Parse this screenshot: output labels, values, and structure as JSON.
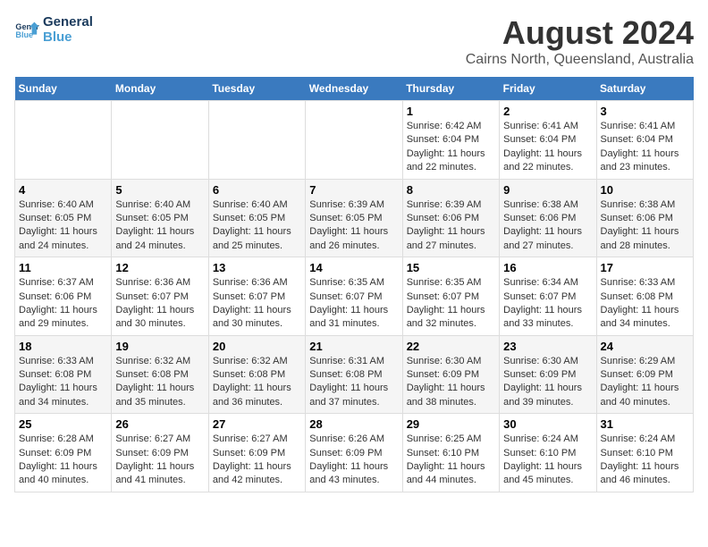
{
  "logo": {
    "line1": "General",
    "line2": "Blue"
  },
  "title": "August 2024",
  "subtitle": "Cairns North, Queensland, Australia",
  "days_header": [
    "Sunday",
    "Monday",
    "Tuesday",
    "Wednesday",
    "Thursday",
    "Friday",
    "Saturday"
  ],
  "weeks": [
    [
      {
        "day": "",
        "info": ""
      },
      {
        "day": "",
        "info": ""
      },
      {
        "day": "",
        "info": ""
      },
      {
        "day": "",
        "info": ""
      },
      {
        "day": "1",
        "info": "Sunrise: 6:42 AM\nSunset: 6:04 PM\nDaylight: 11 hours and 22 minutes."
      },
      {
        "day": "2",
        "info": "Sunrise: 6:41 AM\nSunset: 6:04 PM\nDaylight: 11 hours and 22 minutes."
      },
      {
        "day": "3",
        "info": "Sunrise: 6:41 AM\nSunset: 6:04 PM\nDaylight: 11 hours and 23 minutes."
      }
    ],
    [
      {
        "day": "4",
        "info": "Sunrise: 6:40 AM\nSunset: 6:05 PM\nDaylight: 11 hours and 24 minutes."
      },
      {
        "day": "5",
        "info": "Sunrise: 6:40 AM\nSunset: 6:05 PM\nDaylight: 11 hours and 24 minutes."
      },
      {
        "day": "6",
        "info": "Sunrise: 6:40 AM\nSunset: 6:05 PM\nDaylight: 11 hours and 25 minutes."
      },
      {
        "day": "7",
        "info": "Sunrise: 6:39 AM\nSunset: 6:05 PM\nDaylight: 11 hours and 26 minutes."
      },
      {
        "day": "8",
        "info": "Sunrise: 6:39 AM\nSunset: 6:06 PM\nDaylight: 11 hours and 27 minutes."
      },
      {
        "day": "9",
        "info": "Sunrise: 6:38 AM\nSunset: 6:06 PM\nDaylight: 11 hours and 27 minutes."
      },
      {
        "day": "10",
        "info": "Sunrise: 6:38 AM\nSunset: 6:06 PM\nDaylight: 11 hours and 28 minutes."
      }
    ],
    [
      {
        "day": "11",
        "info": "Sunrise: 6:37 AM\nSunset: 6:06 PM\nDaylight: 11 hours and 29 minutes."
      },
      {
        "day": "12",
        "info": "Sunrise: 6:36 AM\nSunset: 6:07 PM\nDaylight: 11 hours and 30 minutes."
      },
      {
        "day": "13",
        "info": "Sunrise: 6:36 AM\nSunset: 6:07 PM\nDaylight: 11 hours and 30 minutes."
      },
      {
        "day": "14",
        "info": "Sunrise: 6:35 AM\nSunset: 6:07 PM\nDaylight: 11 hours and 31 minutes."
      },
      {
        "day": "15",
        "info": "Sunrise: 6:35 AM\nSunset: 6:07 PM\nDaylight: 11 hours and 32 minutes."
      },
      {
        "day": "16",
        "info": "Sunrise: 6:34 AM\nSunset: 6:07 PM\nDaylight: 11 hours and 33 minutes."
      },
      {
        "day": "17",
        "info": "Sunrise: 6:33 AM\nSunset: 6:08 PM\nDaylight: 11 hours and 34 minutes."
      }
    ],
    [
      {
        "day": "18",
        "info": "Sunrise: 6:33 AM\nSunset: 6:08 PM\nDaylight: 11 hours and 34 minutes."
      },
      {
        "day": "19",
        "info": "Sunrise: 6:32 AM\nSunset: 6:08 PM\nDaylight: 11 hours and 35 minutes."
      },
      {
        "day": "20",
        "info": "Sunrise: 6:32 AM\nSunset: 6:08 PM\nDaylight: 11 hours and 36 minutes."
      },
      {
        "day": "21",
        "info": "Sunrise: 6:31 AM\nSunset: 6:08 PM\nDaylight: 11 hours and 37 minutes."
      },
      {
        "day": "22",
        "info": "Sunrise: 6:30 AM\nSunset: 6:09 PM\nDaylight: 11 hours and 38 minutes."
      },
      {
        "day": "23",
        "info": "Sunrise: 6:30 AM\nSunset: 6:09 PM\nDaylight: 11 hours and 39 minutes."
      },
      {
        "day": "24",
        "info": "Sunrise: 6:29 AM\nSunset: 6:09 PM\nDaylight: 11 hours and 40 minutes."
      }
    ],
    [
      {
        "day": "25",
        "info": "Sunrise: 6:28 AM\nSunset: 6:09 PM\nDaylight: 11 hours and 40 minutes."
      },
      {
        "day": "26",
        "info": "Sunrise: 6:27 AM\nSunset: 6:09 PM\nDaylight: 11 hours and 41 minutes."
      },
      {
        "day": "27",
        "info": "Sunrise: 6:27 AM\nSunset: 6:09 PM\nDaylight: 11 hours and 42 minutes."
      },
      {
        "day": "28",
        "info": "Sunrise: 6:26 AM\nSunset: 6:09 PM\nDaylight: 11 hours and 43 minutes."
      },
      {
        "day": "29",
        "info": "Sunrise: 6:25 AM\nSunset: 6:10 PM\nDaylight: 11 hours and 44 minutes."
      },
      {
        "day": "30",
        "info": "Sunrise: 6:24 AM\nSunset: 6:10 PM\nDaylight: 11 hours and 45 minutes."
      },
      {
        "day": "31",
        "info": "Sunrise: 6:24 AM\nSunset: 6:10 PM\nDaylight: 11 hours and 46 minutes."
      }
    ]
  ]
}
